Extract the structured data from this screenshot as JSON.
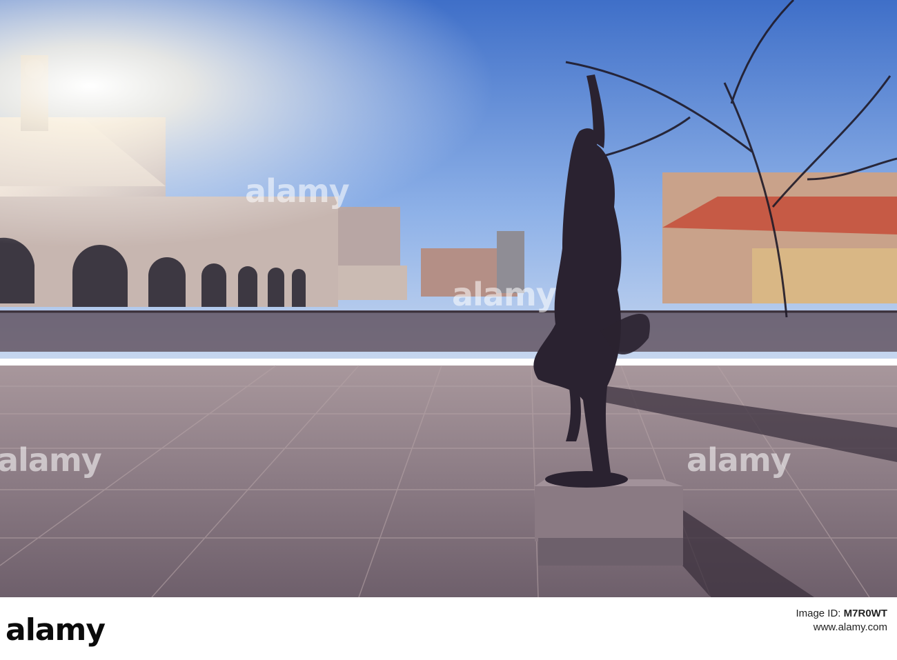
{
  "watermark": {
    "text": "alamy"
  },
  "footer": {
    "logo": "alamy",
    "image_id_label": "Image ID:",
    "image_id": "M7R0WT",
    "url": "www.alamy.com"
  }
}
